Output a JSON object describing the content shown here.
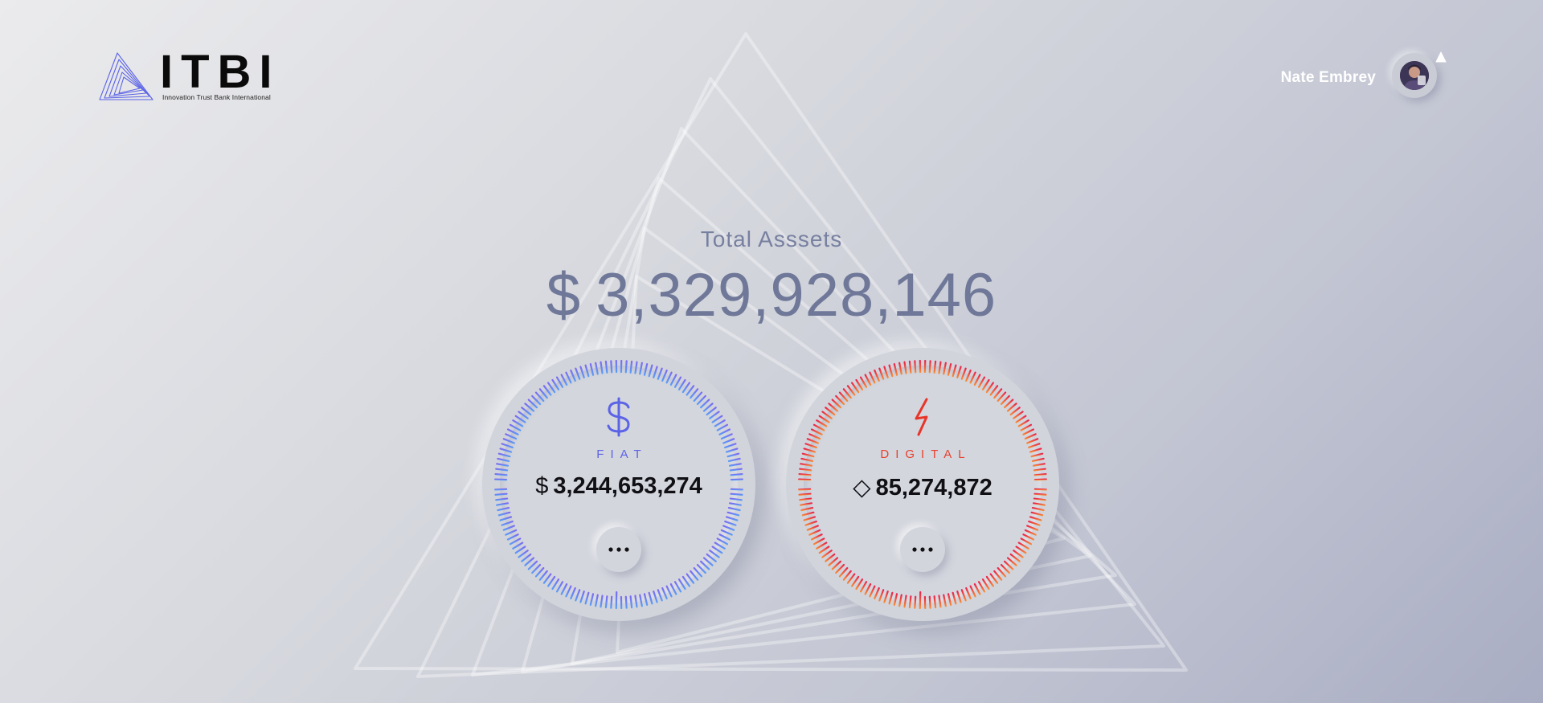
{
  "brand": {
    "name": "ITBI",
    "tagline": "Innovation Trust Bank International",
    "accent_color": "#5b63e6"
  },
  "user": {
    "name": "Nate Embrey",
    "avatar_icon": "user-avatar"
  },
  "summary": {
    "label": "Total Asssets",
    "currency_symbol": "$",
    "value": "3,329,928,146"
  },
  "accounts": [
    {
      "label": "FIAT",
      "icon": "dollar-icon",
      "currency_symbol": "$",
      "amount": "3,244,653,274",
      "colors": [
        "#7a6cf0",
        "#5b9bf5"
      ],
      "more_icon": "more-icon"
    },
    {
      "label": "DIGITAL",
      "icon": "lightning-icon",
      "currency_symbol": "◇",
      "amount": "85,274,872",
      "colors": [
        "#e8264a",
        "#f58a3a"
      ],
      "more_icon": "more-icon"
    }
  ]
}
